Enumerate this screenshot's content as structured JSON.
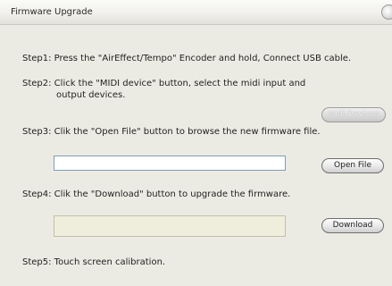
{
  "window": {
    "title": "Firmware Upgrade"
  },
  "steps": {
    "step1": "Step1: Press the \"AirEffect/Tempo\" Encoder and hold, Connect USB cable.",
    "step2_line1": "Step2: Click the \"MIDI device\" button, select the midi input and",
    "step2_line2": "output devices.",
    "step3": "Step3: Clik the \"Open File\" button to browse the new firmware file.",
    "step4": "Step4: Clik the \"Download\" button to  upgrade the firmware.",
    "step5": "Step5: Touch screen calibration."
  },
  "buttons": {
    "midi_devices": "Midi Devices",
    "open_file": "Open File",
    "download": "Download"
  },
  "fields": {
    "file_path_value": "",
    "download_progress_value": ""
  }
}
